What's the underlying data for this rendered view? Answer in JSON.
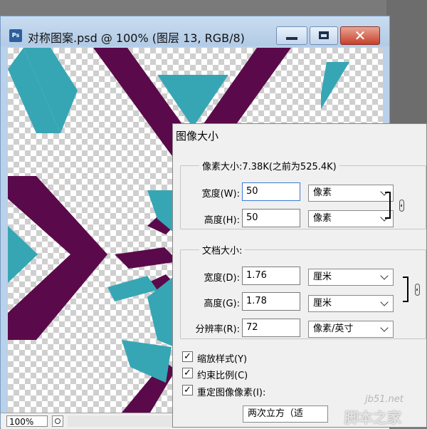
{
  "window": {
    "title": "对称图案.psd @ 100% (图层 13, RGB/8)",
    "icon_text": "Ps",
    "close_symbol": "✕",
    "zoom": "100%"
  },
  "dialog": {
    "title": "图像大小",
    "pixel_dimensions": {
      "legend": "像素大小:7.38K(之前为525.4K)",
      "width_label": "宽度(W):",
      "width_value": "50",
      "width_unit": "像素",
      "height_label": "高度(H):",
      "height_value": "50",
      "height_unit": "像素"
    },
    "document_size": {
      "legend": "文档大小:",
      "width_label": "宽度(D):",
      "width_value": "1.76",
      "width_unit": "厘米",
      "height_label": "高度(G):",
      "height_value": "1.78",
      "height_unit": "厘米",
      "resolution_label": "分辨率(R):",
      "resolution_value": "72",
      "resolution_unit": "像素/英寸"
    },
    "options": {
      "scale_styles": {
        "label": "缩放样式(Y)",
        "checked": true
      },
      "constrain_proportions": {
        "label": "约束比例(C)",
        "checked": true
      },
      "resample": {
        "label": "重定图像像素(I):",
        "checked": true
      },
      "check_mark": "✓"
    },
    "resample_method": "两次立方（适"
  },
  "watermark": {
    "host": "jb51.net",
    "site": "脚本之家"
  },
  "colors": {
    "purple": "#5a0a4a",
    "teal": "#37a6b4"
  }
}
